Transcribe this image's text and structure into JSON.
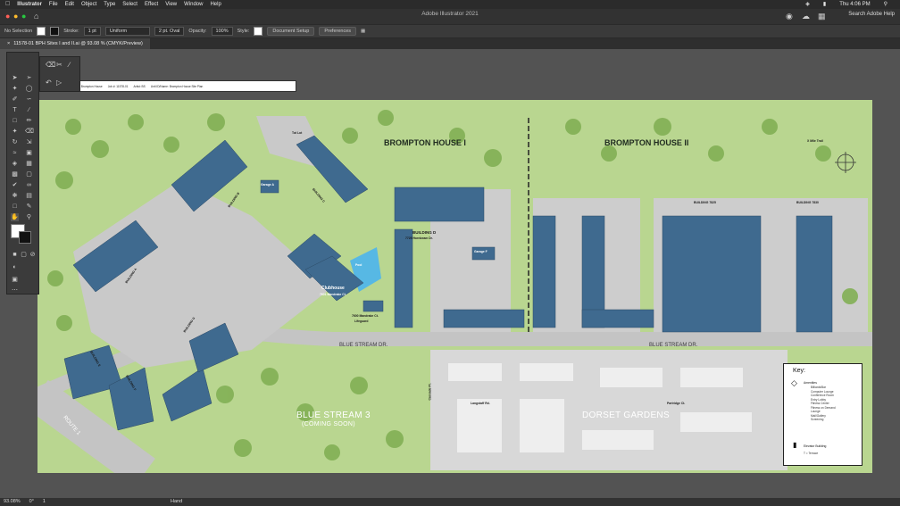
{
  "menubar": {
    "app": "Illustrator",
    "items": [
      "File",
      "Edit",
      "Object",
      "Type",
      "Select",
      "Effect",
      "View",
      "Window",
      "Help"
    ],
    "clock": "Thu 4:06 PM"
  },
  "appbar": {
    "title": "Adobe Illustrator 2021",
    "search": "Search Adobe Help"
  },
  "controlbar": {
    "selection": "No Selection",
    "stroke_label": "Stroke:",
    "stroke_value": "1 pt",
    "profile": "Uniform",
    "brush": "2 pt. Oval",
    "opacity_label": "Opacity:",
    "opacity_value": "100%",
    "style_label": "Style:",
    "doc_setup": "Document Setup",
    "preferences": "Preferences"
  },
  "tab": {
    "label": "11578-01 BPH Sites I and II.ai @ 93.08 % (CMYK/Preview)"
  },
  "statusbar": {
    "zoom": "93.08%",
    "rotation": "0°",
    "page": "1",
    "tool": "Hand"
  },
  "titleblock": {
    "product": "Product: Brompton House",
    "job": "Job #: 11578-01",
    "artist": "Artist: BS",
    "unit": "Unit ID/Name: Brompton House Site Plan"
  },
  "map": {
    "brompton_i": "BROMPTON HOUSE I",
    "brompton_ii": "BROMPTON HOUSE II",
    "blue_stream_3": "BLUE STREAM 3",
    "coming_soon": "(COMING SOON)",
    "dorset": "DORSET GARDENS",
    "blue_stream_dr_1": "BLUE STREAM DR.",
    "blue_stream_dr_2": "BLUE STREAM DR.",
    "route1": "ROUTE 1",
    "clubhouse": "Clubhouse",
    "clubhouse_addr": "7601 Mandrake Ct.",
    "pool": "Pool",
    "tot_lot": "Tot Lot",
    "lifeguard": "Lifeguard",
    "x_mile": "X Mile Trail",
    "building_a": "BUILDING A",
    "building_b": "BUILDING B",
    "building_c": "BUILDING C",
    "building_d": "BUILDING D",
    "building_d_addr": "7725 Hornbeam Dr.",
    "building_e": "BUILDING E",
    "building_f": "BUILDING F",
    "building_g": "BUILDING G",
    "building_7825": "BUILDING 7825",
    "building_7830": "BUILDING 7830",
    "garage_f": "Garage F",
    "garage_a": "Garage A",
    "mandrake_ct": "7600 Mandrake Ct.",
    "cascade": "Cascade Pl.",
    "langstaff": "Langstaff Rd.",
    "partridge": "Partridge Ct."
  },
  "key": {
    "title": "Key:",
    "amenities": "Amenities",
    "list": [
      "Billiards/Bar",
      "Computer Lounge",
      "Conference Room",
      "Entry Lobby",
      "Fitness Center",
      "Fitness on Demand",
      "Lounge",
      "Mail/Gallery",
      "Screening"
    ],
    "elevator": "Elevator Building",
    "terrace": "T = Terrace"
  },
  "colors": {
    "building": "#3f6a8f",
    "grass": "#b9d690",
    "road": "#bdbdbd",
    "tree": "#7eac4f"
  }
}
